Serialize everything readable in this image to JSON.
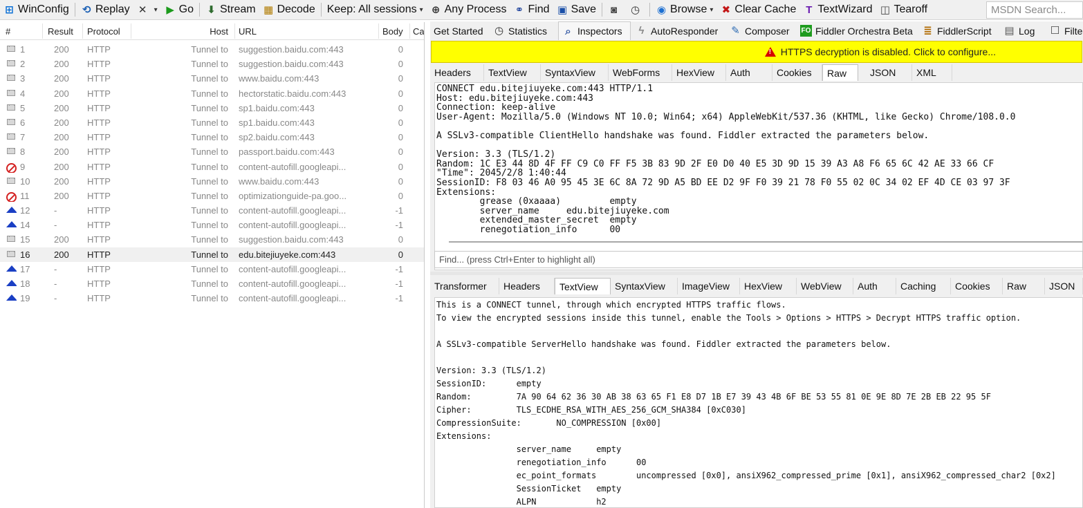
{
  "toolbar": {
    "items": [
      {
        "label": "WinConfig",
        "icon": "windows-logo-icon"
      },
      {
        "label": "Replay",
        "icon": "replay-icon"
      },
      {
        "label": "",
        "icon": "remove-icon",
        "caret": true
      },
      {
        "label": "Go",
        "icon": "play-icon"
      },
      {
        "label": "Stream",
        "icon": "stream-icon"
      },
      {
        "label": "Decode",
        "icon": "decode-icon"
      },
      {
        "label": "Keep: All sessions",
        "icon": "",
        "caret": true
      },
      {
        "label": "Any Process",
        "icon": "crosshair-icon"
      },
      {
        "label": "Find",
        "icon": "binoculars-icon"
      },
      {
        "label": "Save",
        "icon": "save-icon"
      },
      {
        "label": "",
        "icon": "camera-icon"
      },
      {
        "label": "",
        "icon": "timer-icon"
      },
      {
        "label": "Browse",
        "icon": "browser-icon",
        "caret": true
      },
      {
        "label": "Clear Cache",
        "icon": "clear-cache-icon"
      },
      {
        "label": "TextWizard",
        "icon": "text-wizard-icon"
      },
      {
        "label": "Tearoff",
        "icon": "tearoff-icon"
      }
    ],
    "search_placeholder": "MSDN Search..."
  },
  "sessions": {
    "columns": [
      "#",
      "Result",
      "Protocol",
      "Host",
      "URL",
      "Body",
      "Ca"
    ],
    "rows": [
      {
        "num": "1",
        "result": "200",
        "protocol": "HTTP",
        "host": "Tunnel to",
        "url": "suggestion.baidu.com:443",
        "body": "0",
        "icon": "lock-icon"
      },
      {
        "num": "2",
        "result": "200",
        "protocol": "HTTP",
        "host": "Tunnel to",
        "url": "suggestion.baidu.com:443",
        "body": "0",
        "icon": "lock-icon"
      },
      {
        "num": "3",
        "result": "200",
        "protocol": "HTTP",
        "host": "Tunnel to",
        "url": "www.baidu.com:443",
        "body": "0",
        "icon": "lock-icon"
      },
      {
        "num": "4",
        "result": "200",
        "protocol": "HTTP",
        "host": "Tunnel to",
        "url": "hectorstatic.baidu.com:443",
        "body": "0",
        "icon": "lock-icon"
      },
      {
        "num": "5",
        "result": "200",
        "protocol": "HTTP",
        "host": "Tunnel to",
        "url": "sp1.baidu.com:443",
        "body": "0",
        "icon": "lock-icon"
      },
      {
        "num": "6",
        "result": "200",
        "protocol": "HTTP",
        "host": "Tunnel to",
        "url": "sp1.baidu.com:443",
        "body": "0",
        "icon": "lock-icon"
      },
      {
        "num": "7",
        "result": "200",
        "protocol": "HTTP",
        "host": "Tunnel to",
        "url": "sp2.baidu.com:443",
        "body": "0",
        "icon": "lock-icon"
      },
      {
        "num": "8",
        "result": "200",
        "protocol": "HTTP",
        "host": "Tunnel to",
        "url": "passport.baidu.com:443",
        "body": "0",
        "icon": "lock-icon"
      },
      {
        "num": "9",
        "result": "200",
        "protocol": "HTTP",
        "host": "Tunnel to",
        "url": "content-autofill.googleapi...",
        "body": "0",
        "icon": "blocked-icon"
      },
      {
        "num": "10",
        "result": "200",
        "protocol": "HTTP",
        "host": "Tunnel to",
        "url": "www.baidu.com:443",
        "body": "0",
        "icon": "lock-icon"
      },
      {
        "num": "11",
        "result": "200",
        "protocol": "HTTP",
        "host": "Tunnel to",
        "url": "optimizationguide-pa.goo...",
        "body": "0",
        "icon": "blocked-icon"
      },
      {
        "num": "12",
        "result": "-",
        "protocol": "HTTP",
        "host": "Tunnel to",
        "url": "content-autofill.googleapi...",
        "body": "-1",
        "icon": "upload-arrow-icon"
      },
      {
        "num": "14",
        "result": "-",
        "protocol": "HTTP",
        "host": "Tunnel to",
        "url": "content-autofill.googleapi...",
        "body": "-1",
        "icon": "upload-arrow-icon"
      },
      {
        "num": "15",
        "result": "200",
        "protocol": "HTTP",
        "host": "Tunnel to",
        "url": "suggestion.baidu.com:443",
        "body": "0",
        "icon": "lock-icon"
      },
      {
        "num": "16",
        "result": "200",
        "protocol": "HTTP",
        "host": "Tunnel to",
        "url": "edu.bitejiuyeke.com:443",
        "body": "0",
        "icon": "lock-icon",
        "selected": true
      },
      {
        "num": "17",
        "result": "-",
        "protocol": "HTTP",
        "host": "Tunnel to",
        "url": "content-autofill.googleapi...",
        "body": "-1",
        "icon": "upload-arrow-icon"
      },
      {
        "num": "18",
        "result": "-",
        "protocol": "HTTP",
        "host": "Tunnel to",
        "url": "content-autofill.googleapi...",
        "body": "-1",
        "icon": "upload-arrow-icon"
      },
      {
        "num": "19",
        "result": "-",
        "protocol": "HTTP",
        "host": "Tunnel to",
        "url": "content-autofill.googleapi...",
        "body": "-1",
        "icon": "upload-arrow-icon"
      }
    ]
  },
  "main_tabs": [
    {
      "label": "Get Started",
      "icon": ""
    },
    {
      "label": "Statistics",
      "icon": "stopwatch-icon"
    },
    {
      "label": "Inspectors",
      "icon": "inspectors-icon",
      "active": true
    },
    {
      "label": "AutoResponder",
      "icon": "lightning-icon"
    },
    {
      "label": "Composer",
      "icon": "composer-icon"
    },
    {
      "label": "Fiddler Orchestra Beta",
      "icon": "fo-icon"
    },
    {
      "label": "FiddlerScript",
      "icon": "script-icon"
    },
    {
      "label": "Log",
      "icon": "log-icon"
    },
    {
      "label": "Filte",
      "icon": "checkbox-icon"
    }
  ],
  "warning_bar": {
    "text": "HTTPS decryption is disabled. Click to configure..."
  },
  "request_tabs": [
    "Headers",
    "TextView",
    "SyntaxView",
    "WebForms",
    "HexView",
    "Auth",
    "Cookies",
    "Raw",
    "JSON",
    "XML"
  ],
  "request_active_tab": "Raw",
  "request_raw": "CONNECT edu.bitejiuyeke.com:443 HTTP/1.1\nHost: edu.bitejiuyeke.com:443\nConnection: keep-alive\nUser-Agent: Mozilla/5.0 (Windows NT 10.0; Win64; x64) AppleWebKit/537.36 (KHTML, like Gecko) Chrome/108.0.0\n\nA SSLv3-compatible ClientHello handshake was found. Fiddler extracted the parameters below.\n\nVersion: 3.3 (TLS/1.2)\nRandom: 1C E3 44 8D 4F FF C9 C0 FF F5 3B 83 9D 2F E0 D0 40 E5 3D 9D 15 39 A3 A8 F6 65 6C 42 AE 33 66 CF\n\"Time\": 2045/2/8 1:40:44\nSessionID: F8 03 46 A0 95 45 3E 6C 8A 72 9D A5 BD EE D2 9F F0 39 21 78 F0 55 02 0C 34 02 EF 4D CE 03 97 3F\nExtensions:\n\tgrease (0xaaaa)\t\tempty\n\tserver_name\tedu.bitejiuyeke.com\n\textended_master_secret\tempty\n\trenegotiation_info\t00",
  "find_placeholder": "Find... (press Ctrl+Enter to highlight all)",
  "response_tabs": [
    "Transformer",
    "Headers",
    "TextView",
    "SyntaxView",
    "ImageView",
    "HexView",
    "WebView",
    "Auth",
    "Caching",
    "Cookies",
    "Raw",
    "JSON"
  ],
  "response_active_tab": "TextView",
  "response_text": "This is a CONNECT tunnel, through which encrypted HTTPS traffic flows.\nTo view the encrypted sessions inside this tunnel, enable the Tools > Options > HTTPS > Decrypt HTTPS traffic option.\n\nA SSLv3-compatible ServerHello handshake was found. Fiddler extracted the parameters below.\n\nVersion: 3.3 (TLS/1.2)\nSessionID:\tempty\nRandom:\t\t7A 90 64 62 36 30 AB 38 63 65 F1 E8 D7 1B E7 39 43 4B 6F BE 53 55 81 0E 9E 8D 7E 2B EB 22 95 5F\nCipher:\t\tTLS_ECDHE_RSA_WITH_AES_256_GCM_SHA384 [0xC030]\nCompressionSuite:\tNO_COMPRESSION [0x00]\nExtensions:\n\t\tserver_name\tempty\n\t\trenegotiation_info\t00\n\t\tec_point_formats\tuncompressed [0x0], ansiX962_compressed_prime [0x1], ansiX962_compressed_char2 [0x2]\n\t\tSessionTicket\tempty\n\t\tALPN\t\th2"
}
